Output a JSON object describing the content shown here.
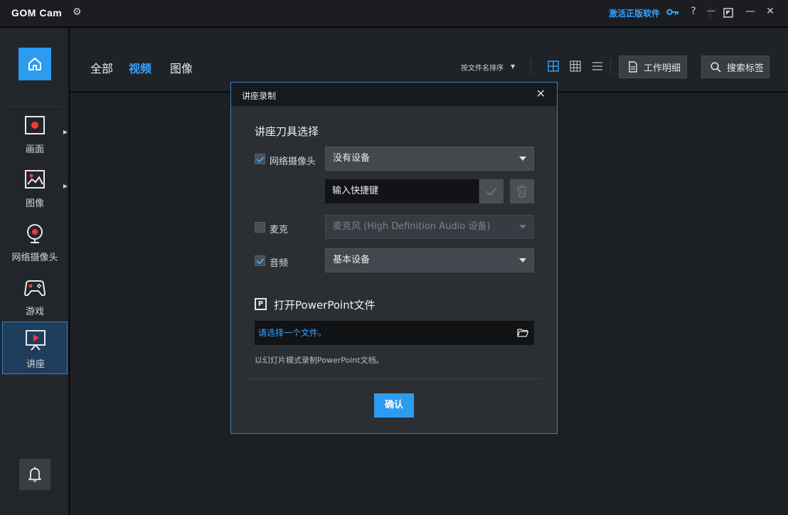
{
  "titlebar": {
    "logo": "GOM Cam",
    "activate": "激活正版软件",
    "help": "?",
    "minimize": "—",
    "close": "✕"
  },
  "sidebar": {
    "items": [
      {
        "label": "画面",
        "icon": "screen-record-icon",
        "has_arrow": true
      },
      {
        "label": "图像",
        "icon": "image-icon",
        "has_arrow": true
      },
      {
        "label": "网络摄像头",
        "icon": "webcam-icon",
        "has_arrow": false
      },
      {
        "label": "游戏",
        "icon": "gamepad-icon",
        "has_arrow": false
      },
      {
        "label": "讲座",
        "icon": "lecture-icon",
        "has_arrow": false,
        "active": true
      }
    ]
  },
  "topnav": {
    "tabs": [
      "全部",
      "视频",
      "图像"
    ],
    "active_tab": "视频",
    "sort_label": "按文件名排序",
    "work_detail": "工作明细",
    "search_tag": "搜索标签"
  },
  "dialog": {
    "title": "讲座录制",
    "section_title": "讲座刀具选择",
    "webcam": {
      "label": "网络摄像头",
      "checked": true,
      "value": "没有设备"
    },
    "hotkey_placeholder": "输入快捷键",
    "mic": {
      "label": "麦克",
      "checked": false,
      "value": "麦克风 (High Definition Audio 设备)"
    },
    "audio": {
      "label": "音频",
      "checked": true,
      "value": "基本设备"
    },
    "ppt_title": "打开PowerPoint文件",
    "ppt_badge": "P",
    "file_placeholder": "请选择一个文件。",
    "hint": "以幻灯片模式录制PowerPoint文档。",
    "confirm": "确认"
  },
  "colors": {
    "accent": "#2d9bf0",
    "link": "#36a3ff",
    "background": "#1c1f23"
  }
}
